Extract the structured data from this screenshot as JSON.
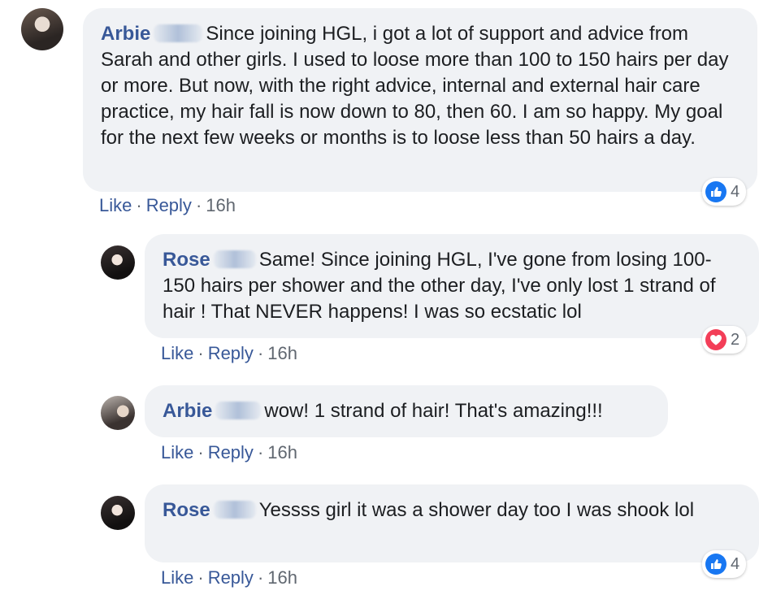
{
  "comments": [
    {
      "name": "Arbie",
      "text": "Since joining HGL, i got a lot of support and advice from Sarah and other girls. I used to loose more than 100 to 150 hairs per day or more. But now, with the right advice, internal and external hair care practice, my hair fall is now down to 80, then 60. I am so happy. My goal for the next few weeks or months is to loose less than 50 hairs a day.",
      "like": "Like",
      "reply": "Reply",
      "time": "16h",
      "reaction": {
        "type": "like",
        "icon": "thumbs-up-icon",
        "color": "#1877f2",
        "count": "4"
      }
    },
    {
      "name": "Rose",
      "text": "Same! Since joining HGL, I've gone from losing 100-150 hairs per shower and the other day, I've only lost 1 strand of hair ! That NEVER happens! I was so ecstatic lol",
      "like": "Like",
      "reply": "Reply",
      "time": "16h",
      "reaction": {
        "type": "love",
        "icon": "heart-icon",
        "color": "#f33e58",
        "count": "2"
      }
    },
    {
      "name": "Arbie",
      "text": "wow! 1 strand of hair! That's amazing!!!",
      "like": "Like",
      "reply": "Reply",
      "time": "16h"
    },
    {
      "name": "Rose",
      "text": "Yessss girl it was a shower day too I was shook lol",
      "like": "Like",
      "reply": "Reply",
      "time": "16h",
      "reaction": {
        "type": "like",
        "icon": "thumbs-up-icon",
        "color": "#1877f2",
        "count": "4"
      }
    }
  ],
  "separator": "·"
}
